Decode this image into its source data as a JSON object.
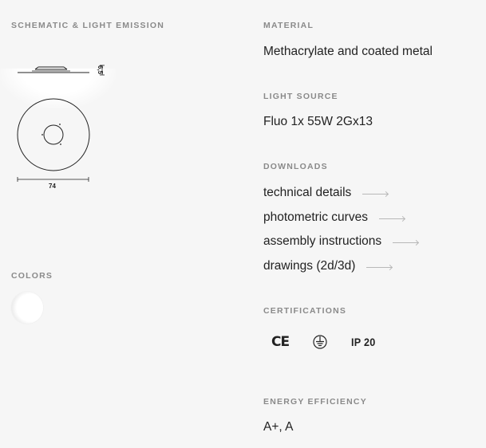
{
  "schematic": {
    "label": "SCHEMATIC & LIGHT EMISSION",
    "height_dim": "6,5",
    "width_dim": "74"
  },
  "colors": {
    "label": "COLORS",
    "swatch_color": "#ffffff"
  },
  "material": {
    "label": "MATERIAL",
    "value": "Methacrylate and coated metal"
  },
  "light_source": {
    "label": "LIGHT SOURCE",
    "value": "Fluo 1x 55W 2Gx13"
  },
  "downloads": {
    "label": "DOWNLOADS",
    "items": [
      {
        "label": "technical details",
        "icon": "arrow-right-icon"
      },
      {
        "label": "photometric curves",
        "icon": "arrow-right-icon"
      },
      {
        "label": "assembly instructions",
        "icon": "arrow-right-icon"
      },
      {
        "label": "drawings (2d/3d)",
        "icon": "arrow-right-icon"
      }
    ]
  },
  "certifications": {
    "label": "CERTIFICATIONS",
    "ce": "CE",
    "ground_icon": "ground-symbol-icon",
    "ip": "IP 20"
  },
  "energy": {
    "label": "ENERGY EFFICIENCY",
    "value": "A+, A"
  }
}
